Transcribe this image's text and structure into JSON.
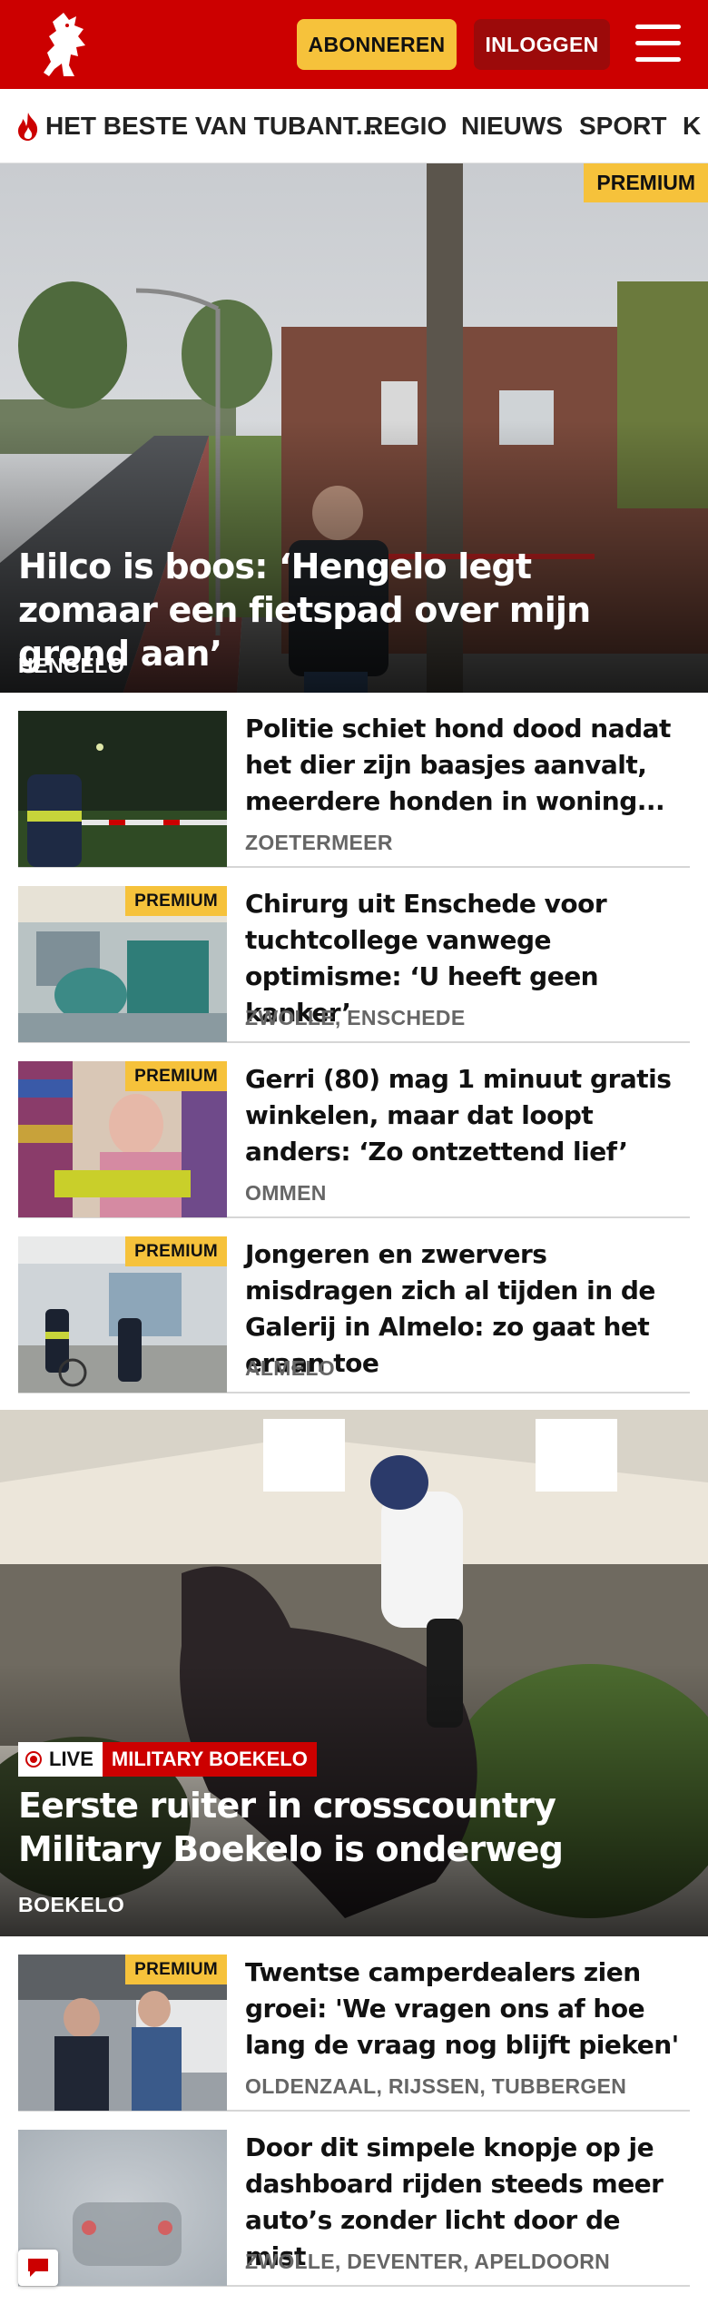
{
  "header": {
    "subscribe_label": "ABONNEREN",
    "login_label": "INLOGGEN",
    "logo_icon": "tubantia-horse-logo",
    "menu_icon": "hamburger-menu-icon",
    "brand_color": "#cc0000",
    "accent_color": "#f6c23b"
  },
  "nav": {
    "items": [
      {
        "label": "HET BESTE VAN TUBANT...",
        "icon": "flame-icon"
      },
      {
        "label": "REGIO"
      },
      {
        "label": "NIEUWS"
      },
      {
        "label": "SPORT"
      },
      {
        "label": "K"
      }
    ]
  },
  "hero": {
    "badge": "PREMIUM",
    "title": "Hilco is boos: ‘Hengelo legt zomaar een fietspad over mijn grond aan’",
    "location": "HENGELO"
  },
  "articles": [
    {
      "title": "Politie schiet hond dood nadat het dier zijn baasjes aanvalt, meerdere honden in woning...",
      "location": "ZOETERMEER",
      "premium": ""
    },
    {
      "title": "Chirurg uit Enschede voor tuchtcollege vanwege optimisme: ‘U heeft geen kanker’",
      "location": "ZWOLLE, ENSCHEDE",
      "premium": "PREMIUM"
    },
    {
      "title": "Gerri (80) mag 1 minuut gratis winkelen, maar dat loopt anders: ‘Zo ontzettend lief’",
      "location": "OMMEN",
      "premium": "PREMIUM"
    },
    {
      "title": "Jongeren en zwervers misdragen zich al tijden in de Galerij in Almelo: zo gaat het eraan toe",
      "location": "ALMELO",
      "premium": "PREMIUM"
    }
  ],
  "live_hero": {
    "live_label": "LIVE",
    "tag": "MILITARY BOEKELO",
    "title": "Eerste ruiter in crosscountry Military Boekelo is onderweg",
    "location": "BOEKELO"
  },
  "articles2": [
    {
      "title": "Twentse camperdealers zien groei: 'We vragen ons af hoe lang de vraag nog blijft pieken'",
      "location": "OLDENZAAL, RIJSSEN, TUBBERGEN",
      "premium": "PREMIUM"
    },
    {
      "title": "Door dit simpele knopje op je dashboard rijden steeds meer auto’s zonder licht door de mist",
      "location": "ZWOLLE, DEVENTER, APELDOORN",
      "premium": ""
    }
  ],
  "chat_icon": "chat-bubble-icon"
}
